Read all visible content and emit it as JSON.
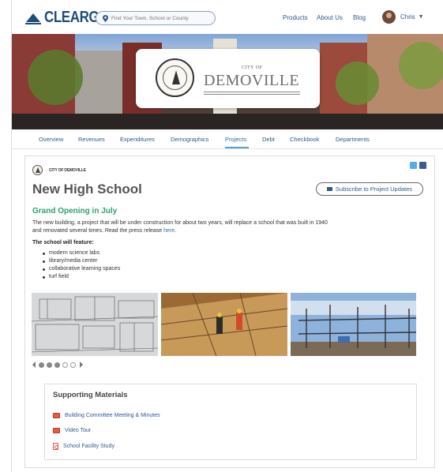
{
  "header": {
    "logo_text": "CLEARGOV",
    "search_placeholder": "Find Your Town, School or County",
    "nav": [
      "Products",
      "About Us",
      "Blog"
    ],
    "user_name": "Chris"
  },
  "hero": {
    "city_of": "CITY OF",
    "city_name": "DEMOVILLE"
  },
  "tabs": {
    "items": [
      "Overview",
      "Revenues",
      "Expenditures",
      "Demographics",
      "Projects",
      "Debt",
      "Checkbook",
      "Departments"
    ],
    "active": "Projects"
  },
  "project": {
    "breadcrumb": "CITY OF DEMOVILLE",
    "title": "New High School",
    "subscribe_label": "Subscribe to Project Updates",
    "heading": "Grand Opening in July",
    "description": "The new building, a project that will be under construction for about two years, will replace a school that was built in 1940 and renovated several times. Read the press release",
    "description_link": "here",
    "features_label": "The school will feature:",
    "features": [
      "modern science labs",
      "library/media center",
      "collaborative learning spaces",
      "turf field"
    ]
  },
  "carousel": {
    "total_dots": 5,
    "filled_dots": 3
  },
  "materials": {
    "title": "Supporting Materials",
    "items": [
      {
        "label": "Building Committee Meeting & Minutes",
        "icon": "video-icon"
      },
      {
        "label": "Video Tour",
        "icon": "video-icon"
      },
      {
        "label": "School Facility Study",
        "icon": "pdf-icon"
      }
    ]
  },
  "colors": {
    "brand": "#1f4e79",
    "link": "#2b5b8c",
    "heading_green": "#2ea36a",
    "twitter": "#55acee",
    "facebook": "#3b5998"
  }
}
